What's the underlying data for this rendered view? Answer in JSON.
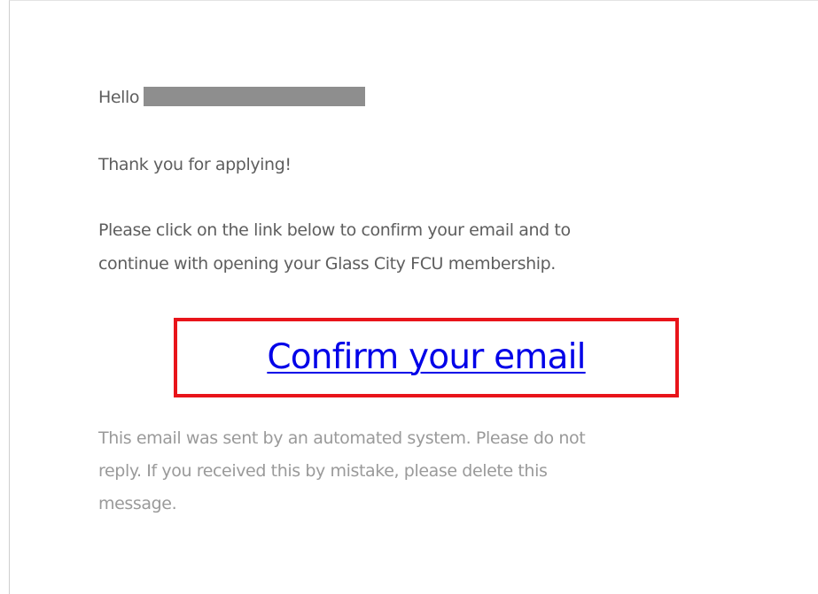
{
  "email": {
    "greeting": "Hello",
    "thanks": "Thank you for applying!",
    "instructions_line1": "Please click on the link below to confirm your email and to",
    "instructions_line2": "continue with opening your Glass City FCU membership.",
    "confirm_link_label": "Confirm your email",
    "footer_line1": "This email was sent by an automated system. Please do not",
    "footer_line2": "reply. If you received this by mistake, please delete this",
    "footer_line3": "message."
  },
  "colors": {
    "body_text": "#5e5e5e",
    "footer_text": "#9a9a9a",
    "link": "#0000e8",
    "highlight_border": "#e8141a",
    "redaction": "#8e8e8e"
  }
}
